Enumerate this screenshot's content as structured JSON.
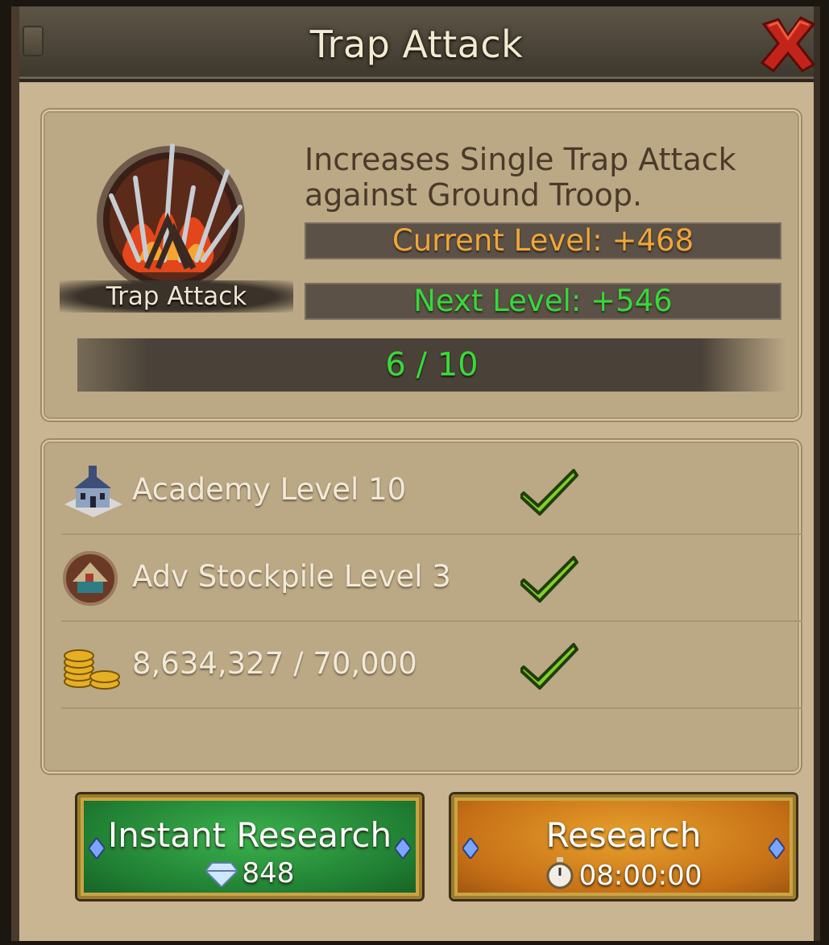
{
  "header": {
    "title": "Trap Attack"
  },
  "skill": {
    "name": "Trap Attack",
    "description": "Increases Single Trap Attack against Ground Troop.",
    "current_level": "Current Level: +468",
    "next_level": "Next Level: +546",
    "progress_text": "6 / 10",
    "progress_fraction": 0.6
  },
  "requirements": [
    {
      "label": "Academy Level 10",
      "icon": "academy-icon",
      "met": true
    },
    {
      "label": "Adv Stockpile Level 3",
      "icon": "stockpile-icon",
      "met": true
    },
    {
      "label": "8,634,327 / 70,000",
      "icon": "gold-coins-icon",
      "met": true
    }
  ],
  "buttons": {
    "instant": {
      "label": "Instant Research",
      "cost": "848"
    },
    "research": {
      "label": "Research",
      "time": "08:00:00"
    }
  },
  "colors": {
    "current_level": "#f0a63a",
    "next_level": "#37d83a",
    "instant_button": "#1f7d32",
    "research_button": "#c56f16"
  }
}
